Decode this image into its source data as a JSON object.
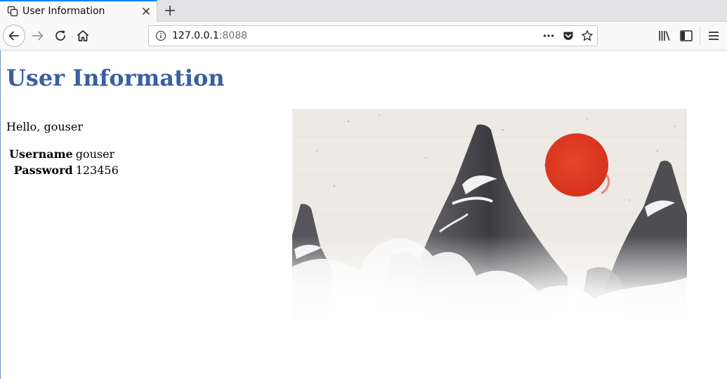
{
  "browser": {
    "tab_title": "User Information",
    "url_host": "127.0.0.1",
    "url_port": ":8088"
  },
  "page": {
    "title": "User Information",
    "greeting": "Hello, gouser",
    "fields": [
      {
        "label": "Username",
        "value": "gouser"
      },
      {
        "label": "Password",
        "value": "123456"
      }
    ],
    "image": {
      "subject": "ink-wash mountains with red sun",
      "sun_color": "#e53a22"
    }
  },
  "colors": {
    "title": "#3a5f9f",
    "accent": "#0a84ff"
  },
  "icons": {
    "tab": [
      "tab-favicon-icon",
      "close-icon",
      "plus-icon"
    ],
    "nav": [
      "back-arrow-icon",
      "forward-arrow-icon",
      "reload-icon",
      "home-icon"
    ],
    "urlbar": [
      "info-icon",
      "more-dots-icon",
      "pocket-icon",
      "star-icon"
    ],
    "toolbar": [
      "library-icon",
      "sidebar-icon",
      "menu-icon"
    ]
  }
}
